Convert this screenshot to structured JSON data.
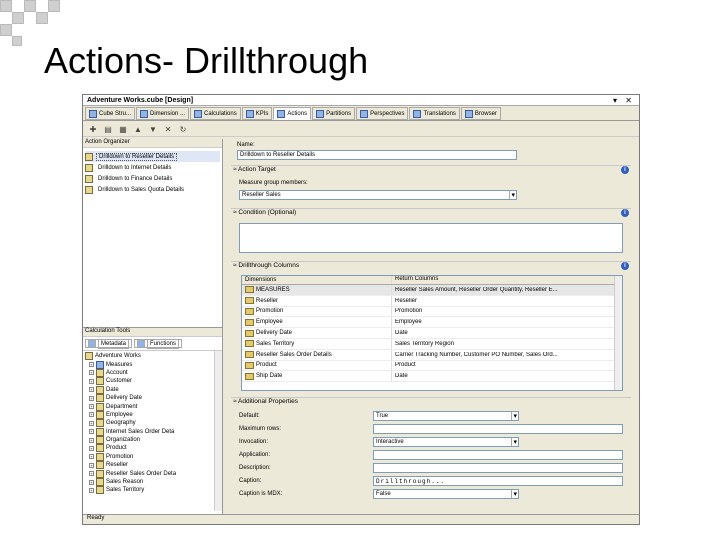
{
  "slide": {
    "title": "Actions- Drillthrough"
  },
  "window": {
    "doc_title": "Adventure Works.cube [Design]",
    "controls": "▾ ✕"
  },
  "tabs": [
    "Cube Stru...",
    "Dimension ...",
    "Calculations",
    "KPIs",
    "Actions",
    "Partitions",
    "Perspectives",
    "Translations",
    "Browser"
  ],
  "active_tab": 4,
  "left": {
    "organizer_header": "Action Organizer",
    "actions": [
      "Drilldown to Reseller Details",
      "Drilldown to Internet Details",
      "Drilldown to Finance Details",
      "Drilldown to Sales Quota Details"
    ],
    "calc_header": "Calculation Tools",
    "calc_tabs": [
      "Metadata",
      "Functions"
    ],
    "tree": [
      "Adventure Works",
      "Measures",
      "Account",
      "Customer",
      "Date",
      "Delivery Date",
      "Department",
      "Employee",
      "Geography",
      "Internet Sales Order Deta",
      "Organization",
      "Product",
      "Promotion",
      "Reseller",
      "Reseller Sales Order Deta",
      "Sales Reason",
      "Sales Territory"
    ]
  },
  "form": {
    "name_label": "Name:",
    "name_value": "Drilldown to Reseller Details",
    "action_target": "Action Target",
    "measure_group_label": "Measure group members:",
    "measure_group_value": "Reseller Sales",
    "condition": "Condition (Optional)",
    "drill_columns": "Drillthrough Columns",
    "grid_headers": [
      "Dimensions",
      "Return Columns"
    ],
    "grid_rows": [
      [
        "MEASURES",
        "Reseller Sales Amount, Reseller Order Quantity, Reseller E..."
      ],
      [
        "Reseller",
        "Reseller"
      ],
      [
        "Promotion",
        "Promotion"
      ],
      [
        "Employee",
        "Employee"
      ],
      [
        "Delivery Date",
        "Date"
      ],
      [
        "Sales Territory",
        "Sales Territory Region"
      ],
      [
        "Reseller Sales Order Details",
        "Carrier Tracking Number, Customer PO Number, Sales Ord..."
      ],
      [
        "Product",
        "Product"
      ],
      [
        "Ship Date",
        "Date"
      ]
    ],
    "additional": "Additional Properties",
    "props": [
      {
        "label": "Default:",
        "value": "True",
        "dropdown": true
      },
      {
        "label": "Maximum rows:",
        "value": "",
        "dropdown": false
      },
      {
        "label": "Invocation:",
        "value": "Interactive",
        "dropdown": true
      },
      {
        "label": "Application:",
        "value": "",
        "dropdown": false
      },
      {
        "label": "Description:",
        "value": "",
        "dropdown": false
      },
      {
        "label": "Caption:",
        "value": "Drillthrough...",
        "dropdown": false
      },
      {
        "label": "Caption is MDX:",
        "value": "False",
        "dropdown": true
      }
    ]
  },
  "status": "Ready",
  "colors": {
    "selection": "#dfe6f5",
    "info": "#2f5fbf",
    "chrome": "#ece9d8"
  }
}
